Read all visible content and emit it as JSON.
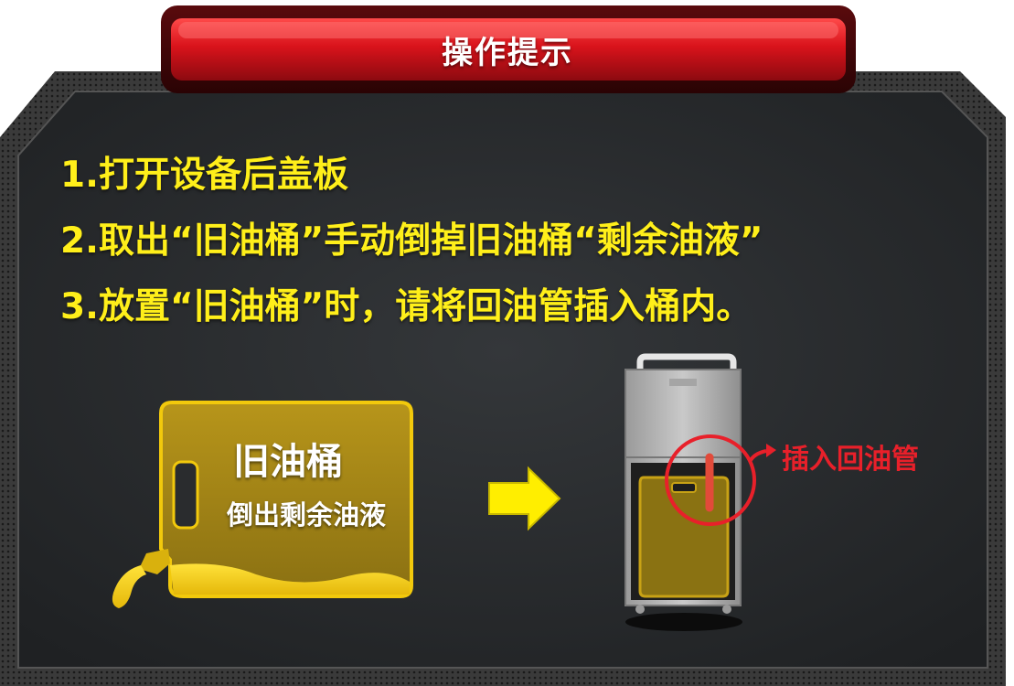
{
  "title_bar": {
    "text": "操作提示"
  },
  "steps": [
    "1.打开设备后盖板",
    "2.取出“旧油桶”手动倒掉旧油桶“剩余油液”",
    "3.放置“旧油桶”时，请将回油管插入桶内。"
  ],
  "illustration_left": {
    "title": "旧油桶",
    "subtitle": "倒出剩余油液"
  },
  "illustration_right": {
    "callout": "插入回油管"
  },
  "colors": {
    "panel": "#2a2c2e",
    "frame": "#3c3c3c",
    "title_red": "#d4151d",
    "step_text": "#ffef1a",
    "oil_yellow": "#f2c90c",
    "callout_red": "#e8202a"
  },
  "icons": [
    "right-arrow-icon",
    "curved-arrow-icon"
  ]
}
